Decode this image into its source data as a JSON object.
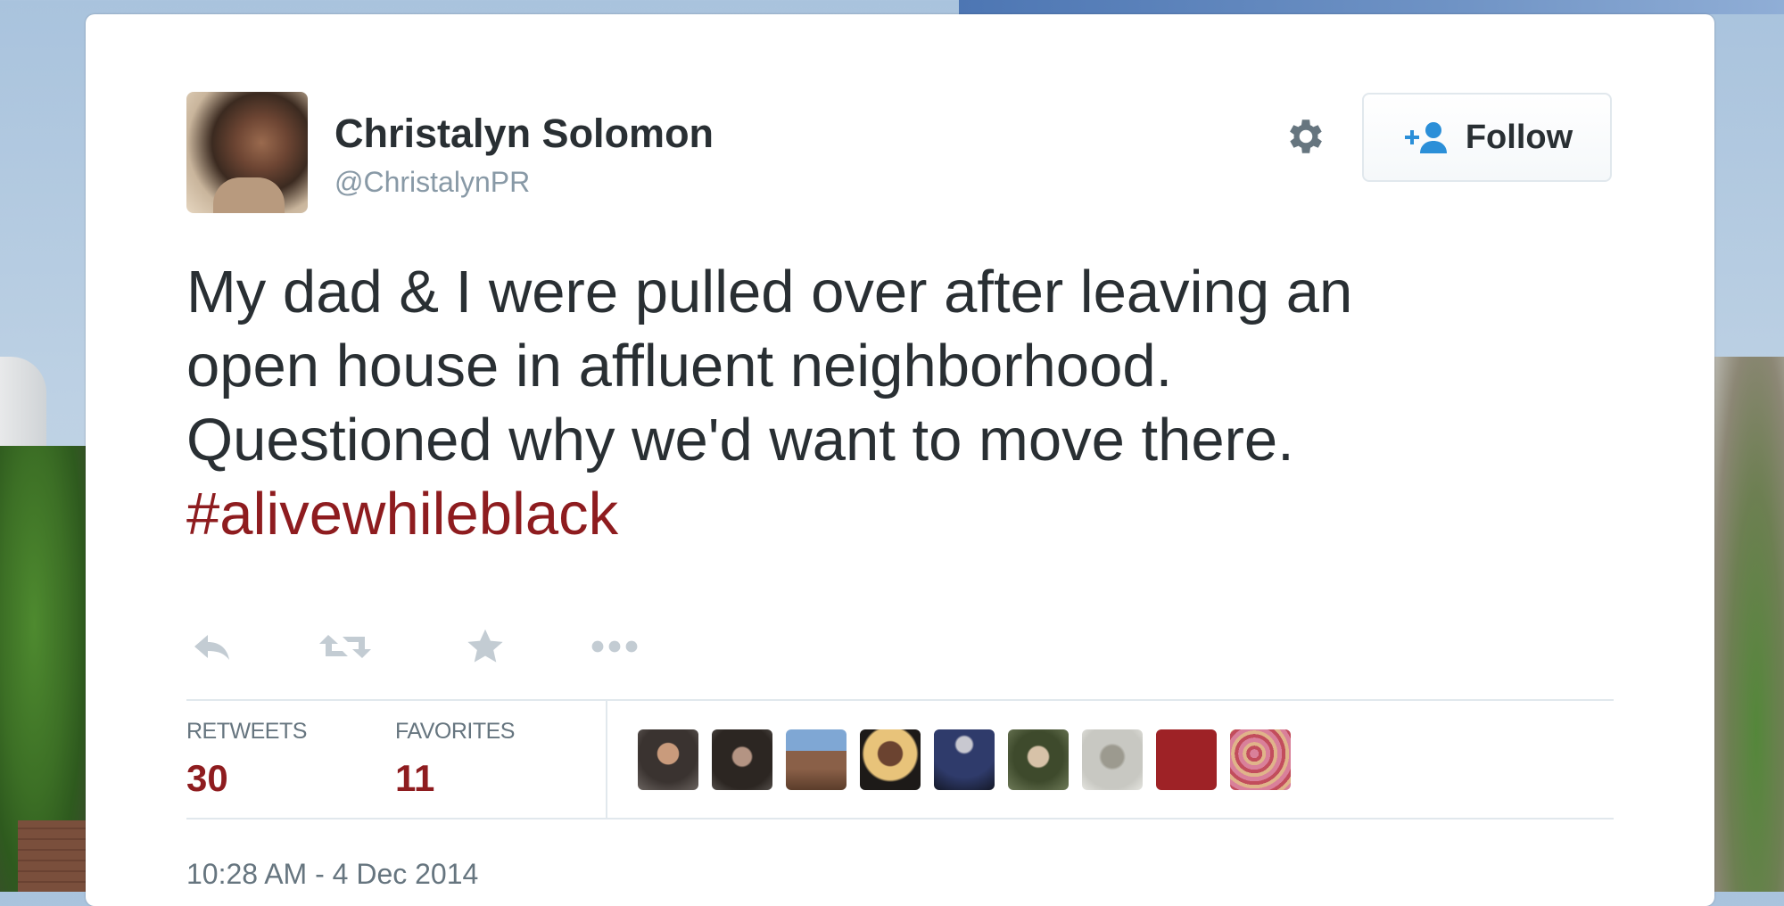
{
  "tweet": {
    "author": {
      "display_name": "Christalyn Solomon",
      "screen_name": "@ChristalynPR"
    },
    "follow_label": "Follow",
    "text_lines": [
      "My dad & I were pulled over after leaving an",
      "open house in affluent neighborhood.",
      "Questioned why we'd want to move there."
    ],
    "hashtag": "#alivewhileblack",
    "actions": {
      "icons": [
        "reply-icon",
        "retweet-icon",
        "favorite-icon",
        "more-icon"
      ]
    },
    "stats": {
      "retweets_label": "RETWEETS",
      "retweets_value": "30",
      "favorites_label": "FAVORITES",
      "favorites_value": "11"
    },
    "timestamp": "10:28 AM - 4 Dec 2014"
  },
  "colors": {
    "accent": "#8e1c1f",
    "text": "#292f33",
    "muted": "#8899a6",
    "border": "#e1e8ed"
  }
}
